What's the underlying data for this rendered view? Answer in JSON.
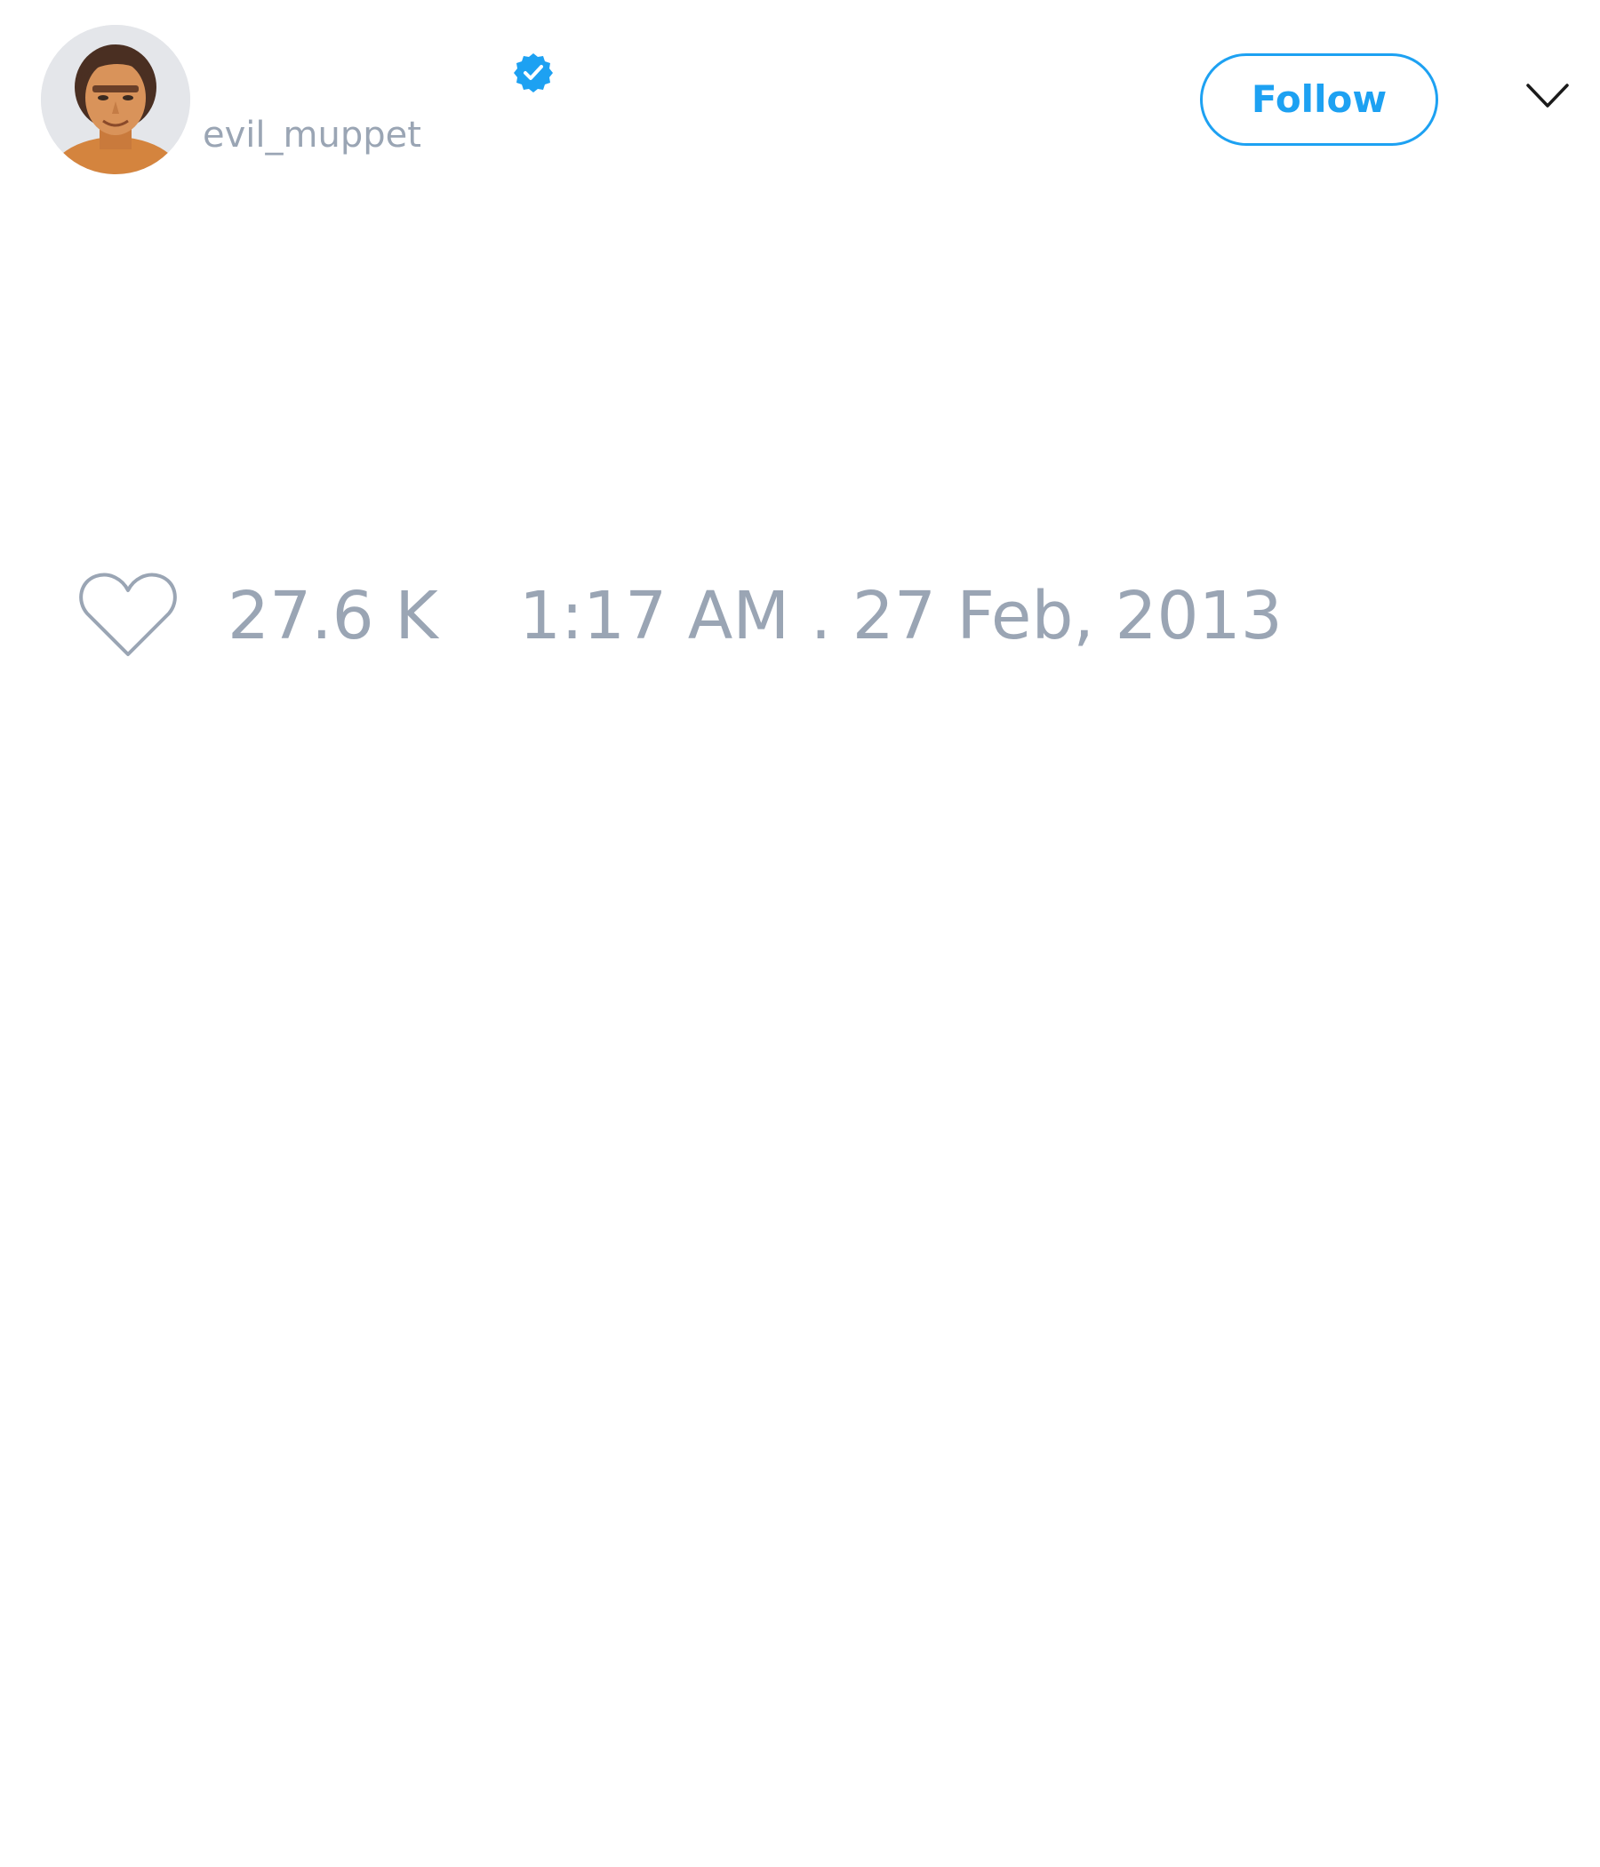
{
  "user": {
    "handle": "evil_muppet",
    "avatar_icon": "profile-photo",
    "verified_icon": "verified-badge-icon"
  },
  "actions": {
    "follow_label": "Follow",
    "menu_icon": "chevron-down-icon"
  },
  "engagement": {
    "like_icon": "heart-outline-icon",
    "like_count": "27.6 K",
    "timestamp": "1:17 AM . 27 Feb, 2013"
  },
  "colors": {
    "accent": "#1da1f2",
    "muted_text": "#9aa5b4",
    "icon_stroke": "#9aa5b4",
    "background": "#ffffff"
  }
}
